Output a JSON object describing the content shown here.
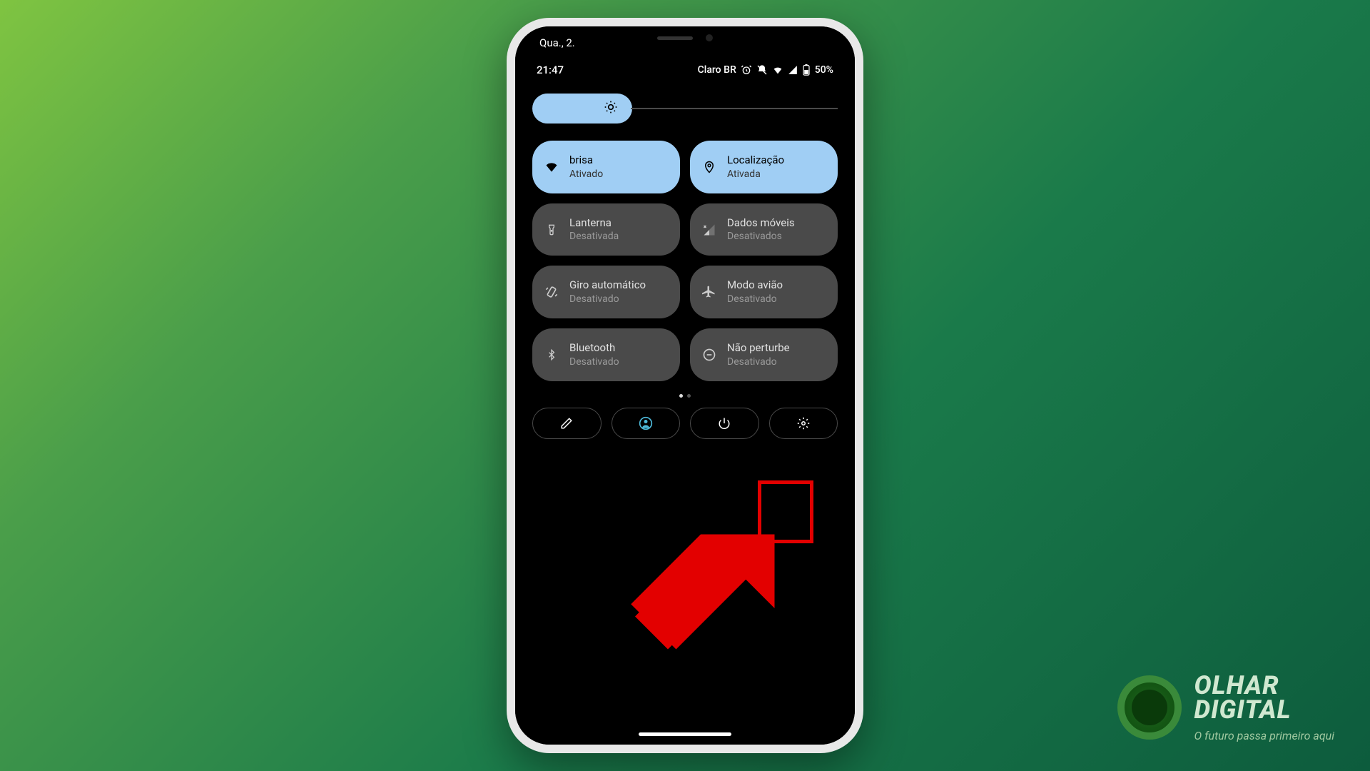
{
  "date": "Qua., 2.",
  "status": {
    "time": "21:47",
    "carrier": "Claro BR",
    "battery": "50%"
  },
  "tiles": [
    {
      "id": "wifi",
      "title": "brisa",
      "status": "Ativado",
      "active": true,
      "icon": "wifi"
    },
    {
      "id": "location",
      "title": "Localização",
      "status": "Ativada",
      "active": true,
      "icon": "location"
    },
    {
      "id": "flashlight",
      "title": "Lanterna",
      "status": "Desativada",
      "active": false,
      "icon": "flashlight"
    },
    {
      "id": "mobile-data",
      "title": "Dados móveis",
      "status": "Desativados",
      "active": false,
      "icon": "mobile-data"
    },
    {
      "id": "auto-rotate",
      "title": "Giro automático",
      "status": "Desativado",
      "active": false,
      "icon": "auto-rotate"
    },
    {
      "id": "airplane",
      "title": "Modo avião",
      "status": "Desativado",
      "active": false,
      "icon": "airplane"
    },
    {
      "id": "bluetooth",
      "title": "Bluetooth",
      "status": "Desativado",
      "active": false,
      "icon": "bluetooth"
    },
    {
      "id": "dnd",
      "title": "Não perturbe",
      "status": "Desativado",
      "active": false,
      "icon": "dnd"
    }
  ],
  "watermark": {
    "line1": "OLHAR",
    "line2": "DIGITAL",
    "tagline": "O futuro passa primeiro aqui"
  },
  "accent": "#a0cef4",
  "highlight_color": "#e30000"
}
